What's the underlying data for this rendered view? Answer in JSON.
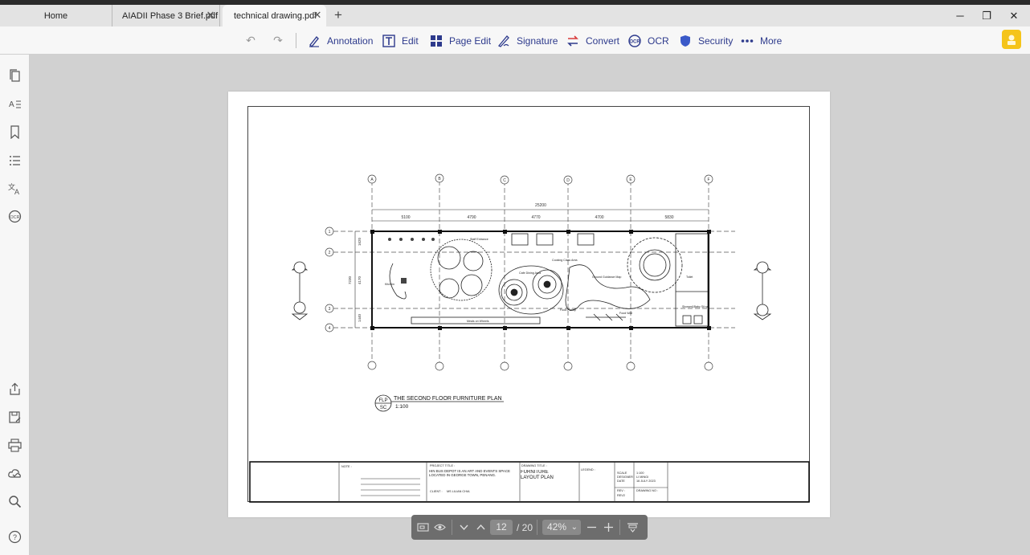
{
  "tabs": [
    {
      "label": "Home"
    },
    {
      "label": "AIADII Phase 3 Brief.pdf"
    },
    {
      "label": "technical drawing.pdf"
    }
  ],
  "toolbar": {
    "annotation": "Annotation",
    "edit": "Edit",
    "page_edit": "Page Edit",
    "signature": "Signature",
    "convert": "Convert",
    "ocr": "OCR",
    "security": "Security",
    "more": "More"
  },
  "document": {
    "plan_title": "THE SECOND FLOOR FURNITURE PLAN",
    "plan_scale": "1:100",
    "plan_tag_top": "FLP",
    "plan_tag_bottom": "SC",
    "overall_dimension": "25200",
    "bay_dimensions": [
      "5100",
      "4790",
      "4770",
      "4700",
      "5830"
    ],
    "grid_columns": [
      "A",
      "B",
      "C",
      "D",
      "E",
      "F"
    ],
    "grid_rows": [
      "1",
      "2",
      "3",
      "4"
    ],
    "side_dimensions": [
      "1620",
      "4170",
      "1440"
    ],
    "side_total": "7230",
    "room_labels": [
      "Staff Entrance",
      "Cooking Class Area",
      "Kitchen",
      "Cafe Dining Area",
      "Ground Guidance Map",
      "Toilet",
      "Shower&Baby Sit set",
      "Meals on Wheels",
      "Food Wall",
      "Food Pickup"
    ],
    "title_block": {
      "notes_label": "NOTE :",
      "project_title_label": "PROJECT TITLE :",
      "project_title": "HIN BUS DEPOT IS AN ART AND EVENTS SPACE LOCATED IN GEORGE TOWN, PENANG.",
      "client_label": "CLIENT :",
      "client": "MS LILIAN CHIA",
      "drawing_title_label": "DRAWING TITLE :",
      "drawing_title": "FURNITURE LAYOUT PLAN",
      "legend_label": "LEGEND :",
      "scale_label": "SCALE",
      "scale": "1:100",
      "designer_label": "DESIGNER",
      "designer": "LI MINGI",
      "date_label": "DATE",
      "date": "16 JULY 2023",
      "rev_label": "REV :",
      "rev": "REV2",
      "drawing_no_label": "DRAWING NO :"
    }
  },
  "pager": {
    "current_page": "12",
    "total": "/ 20",
    "zoom": "42%"
  }
}
